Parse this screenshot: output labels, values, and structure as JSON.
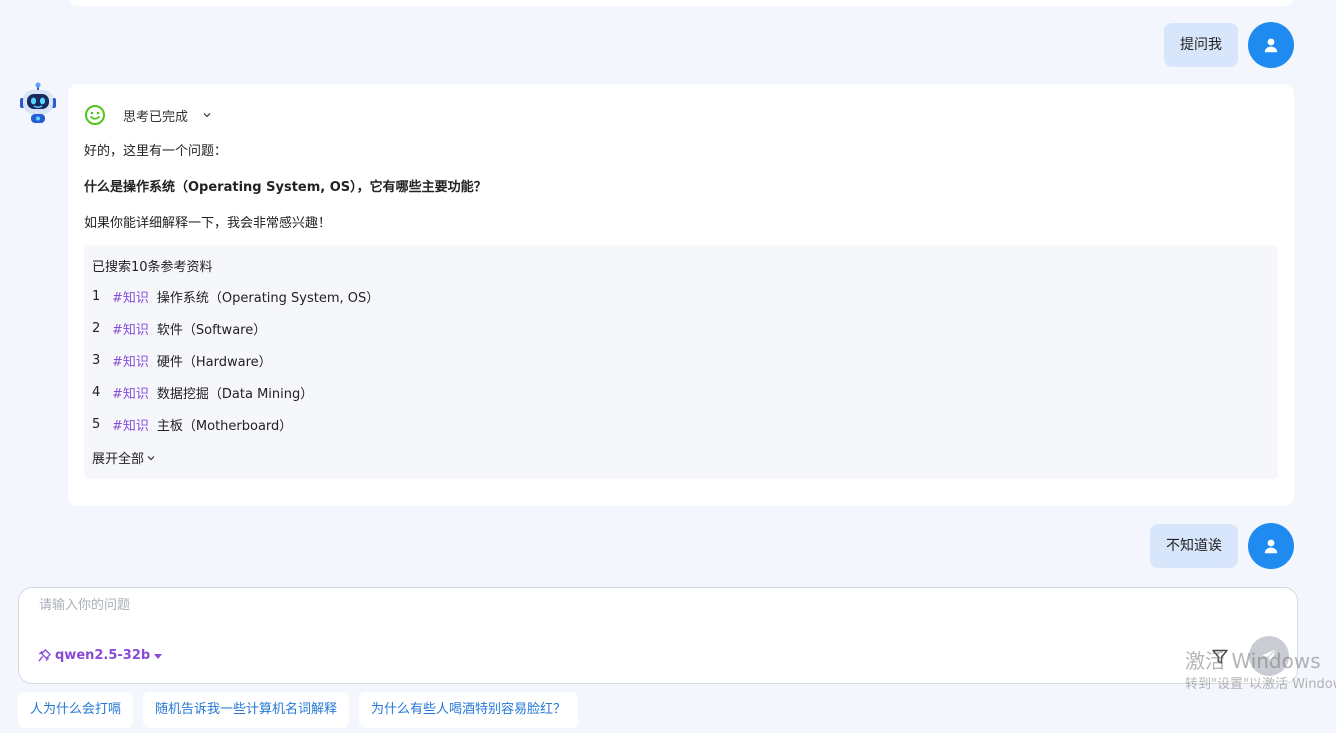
{
  "conversation": {
    "user_messages": [
      "提问我",
      "不知道诶"
    ],
    "bot_message": {
      "thinking_status": "思考已完成",
      "paragraph_1": "好的，这里有一个问题：",
      "question": "什么是操作系统（Operating System, OS），它有哪些主要功能？",
      "paragraph_3": "如果你能详细解释一下，我会非常感兴趣！",
      "references": {
        "title": "已搜索10条参考资料",
        "items": [
          {
            "num": "1",
            "tag": "#知识",
            "text": "操作系统（Operating System, OS）"
          },
          {
            "num": "2",
            "tag": "#知识",
            "text": "软件（Software）"
          },
          {
            "num": "3",
            "tag": "#知识",
            "text": "硬件（Hardware）"
          },
          {
            "num": "4",
            "tag": "#知识",
            "text": "数据挖掘（Data Mining）"
          },
          {
            "num": "5",
            "tag": "#知识",
            "text": "主板（Motherboard）"
          }
        ],
        "expand_label": "展开全部"
      }
    }
  },
  "input": {
    "placeholder": "请输入你的问题",
    "value": "",
    "model_label": "qwen2.5-32b"
  },
  "suggestions": [
    "人为什么会打嗝",
    "随机告诉我一些计算机名词解释",
    "为什么有些人喝酒特别容易脸红？"
  ],
  "watermark": {
    "line1": "激活 Windows",
    "line2": "转到\"设置\"以激活 Windows。"
  },
  "colors": {
    "accent_blue": "#1f8bf0",
    "user_bubble": "#d7e6fb",
    "tag_purple": "#8a4bd8",
    "think_green": "#52c41a",
    "chip_text": "#2478d6"
  },
  "icons": [
    "user-icon",
    "robot-icon",
    "smile-icon",
    "chevron-down-icon",
    "send-icon",
    "filter-icon",
    "model-icon",
    "caret-down-icon"
  ]
}
